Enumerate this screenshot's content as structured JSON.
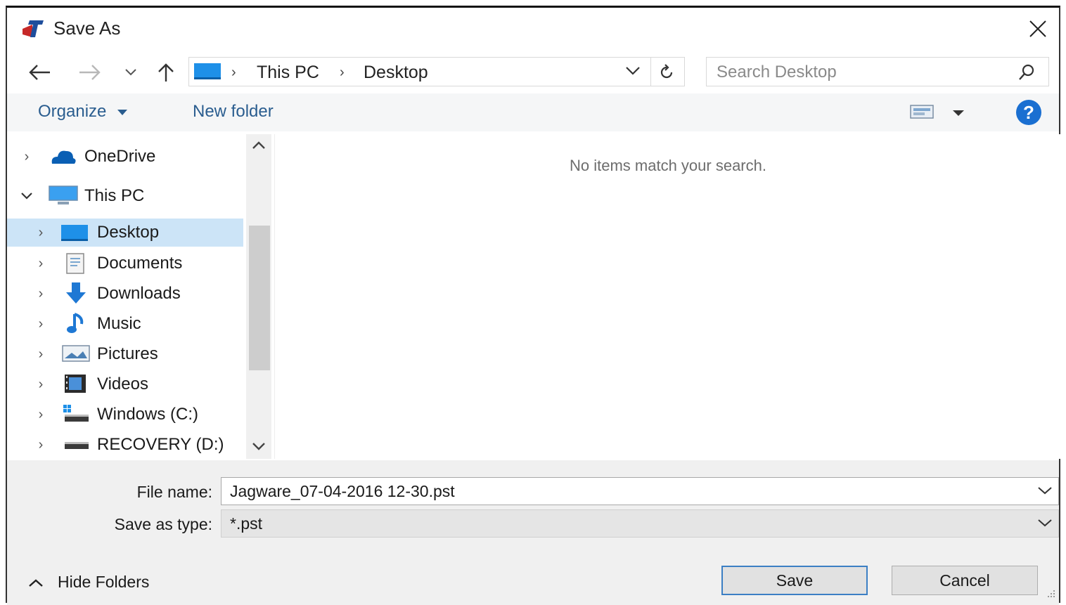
{
  "window": {
    "title": "Save As",
    "icons": {
      "app": "outlook-app-icon",
      "close": "close-icon"
    }
  },
  "address": {
    "root_icon": "computer-icon",
    "crumbs": [
      "This PC",
      "Desktop"
    ],
    "search_placeholder": "Search Desktop"
  },
  "toolbar": {
    "organize_label": "Organize",
    "new_folder_label": "New folder"
  },
  "nav_tree": [
    {
      "label": "OneDrive",
      "icon": "onedrive-cloud-icon",
      "expanded": false,
      "selected": false
    },
    {
      "label": "This PC",
      "icon": "this-pc-icon",
      "expanded": true,
      "selected": false
    },
    {
      "label": "Desktop",
      "icon": "desktop-folder-icon",
      "expanded": false,
      "selected": true
    },
    {
      "label": "Documents",
      "icon": "documents-icon",
      "expanded": false,
      "selected": false
    },
    {
      "label": "Downloads",
      "icon": "downloads-icon",
      "expanded": false,
      "selected": false
    },
    {
      "label": "Music",
      "icon": "music-icon",
      "expanded": false,
      "selected": false
    },
    {
      "label": "Pictures",
      "icon": "pictures-icon",
      "expanded": false,
      "selected": false
    },
    {
      "label": "Videos",
      "icon": "videos-icon",
      "expanded": false,
      "selected": false
    },
    {
      "label": "Windows (C:)",
      "icon": "windows-drive-icon",
      "expanded": false,
      "selected": false
    },
    {
      "label": "RECOVERY (D:)",
      "icon": "drive-icon",
      "expanded": false,
      "selected": false
    }
  ],
  "content": {
    "empty_message": "No items match your search."
  },
  "form": {
    "file_name_label": "File name:",
    "file_name_value": "Jagware_07-04-2016 12-30.pst",
    "save_type_label": "Save as type:",
    "save_type_value": "*.pst"
  },
  "actions": {
    "save_label": "Save",
    "cancel_label": "Cancel",
    "hide_folders_label": "Hide Folders"
  },
  "colors": {
    "accent": "#3c7fc4",
    "selection": "#cce4f7",
    "link": "#2a5d8f",
    "help": "#1a6fd1"
  }
}
